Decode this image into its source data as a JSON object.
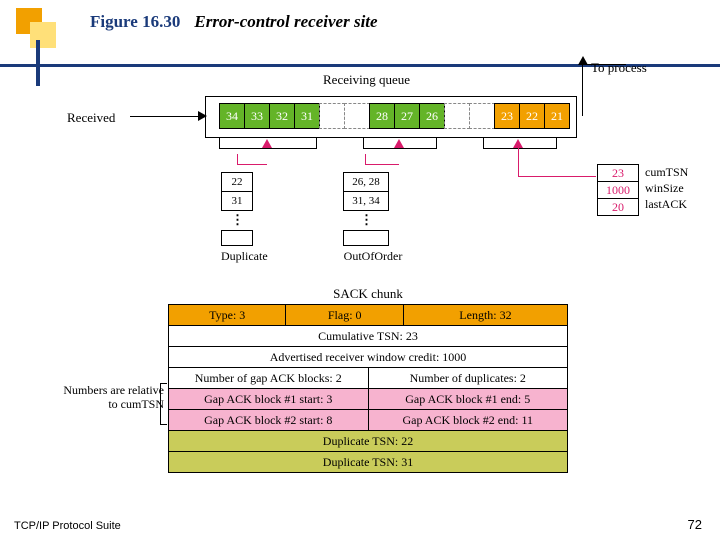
{
  "figure": {
    "label": "Figure 16.30",
    "caption": "Error-control receiver site"
  },
  "footer": {
    "left": "TCP/IP Protocol Suite",
    "page": "72"
  },
  "labels": {
    "receiving_queue": "Receiving queue",
    "received": "Received",
    "to_process": "To process",
    "duplicate": "Duplicate",
    "out_of_order": "OutOfOrder",
    "sack_chunk": "SACK chunk",
    "note": "Numbers are relative to cumTSN"
  },
  "queue": {
    "group1": [
      "34",
      "33",
      "32",
      "31"
    ],
    "gap1": 2,
    "group2": [
      "28",
      "27",
      "26"
    ],
    "gap2": 2,
    "group3": [
      "23",
      "22",
      "21"
    ]
  },
  "dup_queue": [
    "22",
    "31"
  ],
  "ooo_queue": [
    "26, 28",
    "31, 34"
  ],
  "params": {
    "values": [
      "23",
      "1000",
      "20"
    ],
    "names": [
      "cumTSN",
      "winSize",
      "lastACK"
    ]
  },
  "sack": {
    "head": {
      "type": "Type: 3",
      "flag": "Flag: 0",
      "length": "Length: 32"
    },
    "cum": "Cumulative TSN: 23",
    "adv": "Advertised receiver window credit: 1000",
    "counts": {
      "gaps": "Number of gap ACK blocks: 2",
      "dups": "Number of duplicates: 2"
    },
    "gap1": {
      "start": "Gap ACK block #1 start: 3",
      "end": "Gap ACK block #1 end: 5"
    },
    "gap2": {
      "start": "Gap ACK block #2 start: 8",
      "end": "Gap ACK block #2 end: 11"
    },
    "dup1": "Duplicate TSN: 22",
    "dup2": "Duplicate TSN: 31"
  }
}
